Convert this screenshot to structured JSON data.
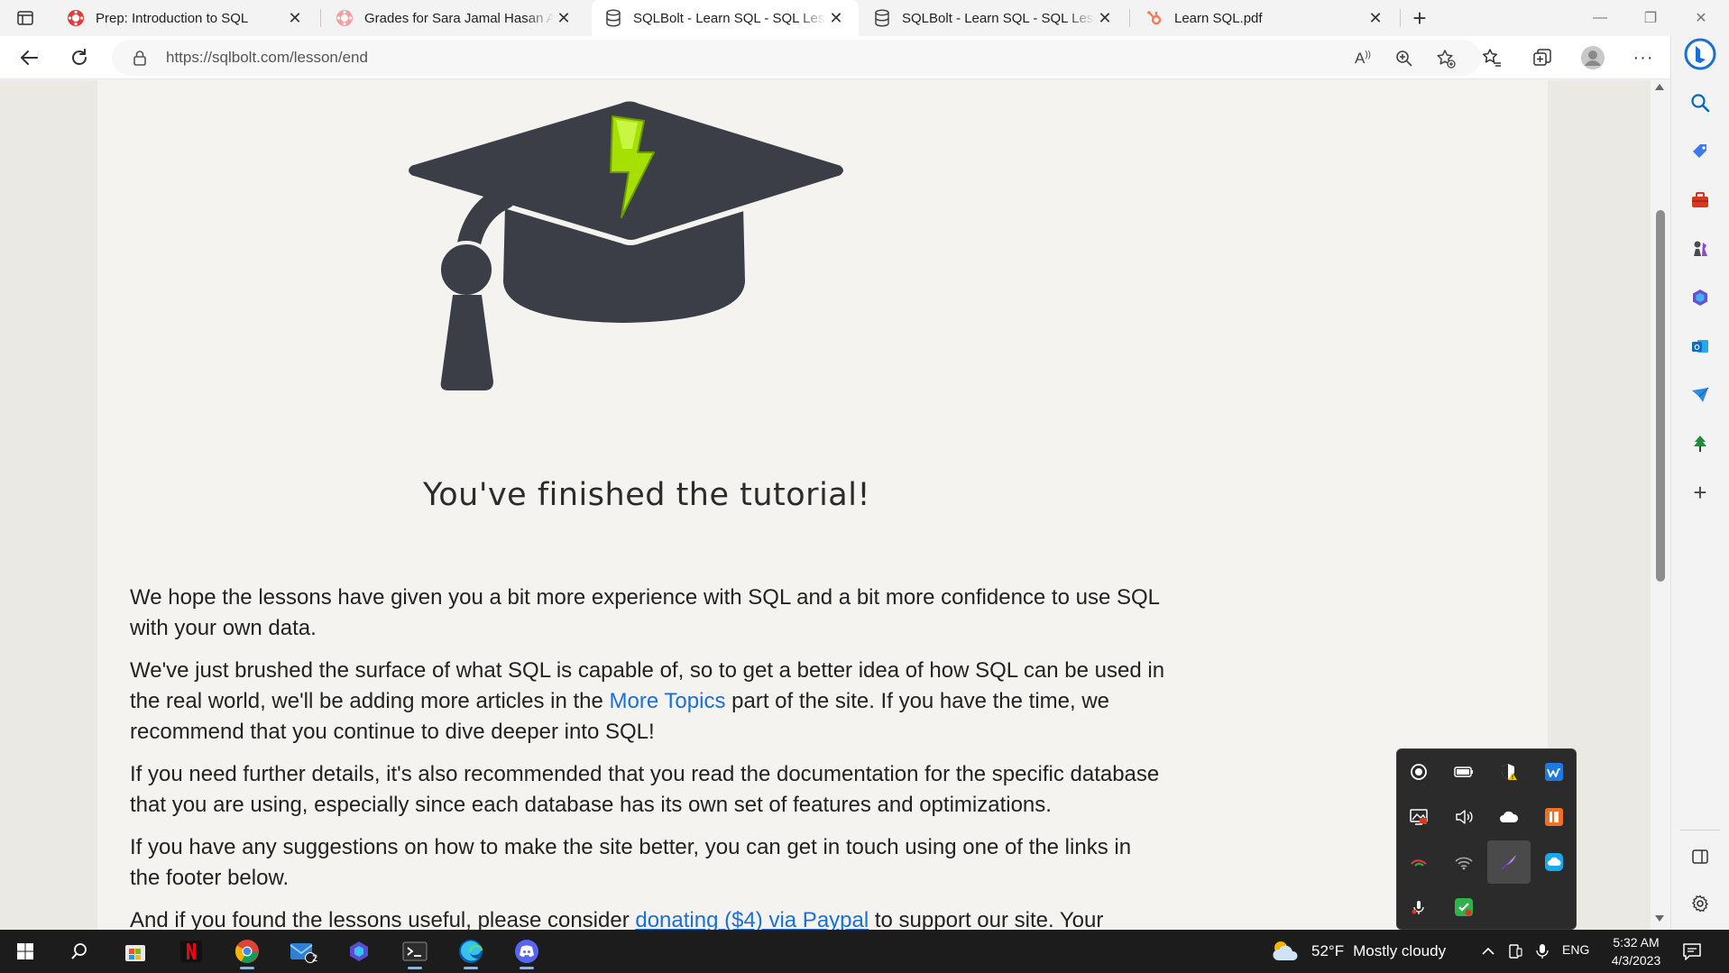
{
  "browser": {
    "tabs": [
      {
        "title": "Prep: Introduction to SQL",
        "icon": "codepath-icon",
        "active": false
      },
      {
        "title": "Grades for Sara Jamal Hasan Alki",
        "icon": "codepath-icon",
        "active": false
      },
      {
        "title": "SQLBolt - Learn SQL - SQL Lesso",
        "icon": "database-icon",
        "active": true
      },
      {
        "title": "SQLBolt - Learn SQL - SQL Lesso",
        "icon": "database-icon",
        "active": false
      },
      {
        "title": "Learn SQL.pdf",
        "icon": "hubspot-icon",
        "active": false
      }
    ],
    "url": "https://sqlbolt.com/lesson/end"
  },
  "page": {
    "heading": "You've finished the tutorial!",
    "p1": "We hope the lessons have given you a bit more experience with SQL and a bit more confidence to use SQL with your own data.",
    "p2_before": "We've just brushed the surface of what SQL is capable of, so to get a better idea of how SQL can be used in the real world, we'll be adding more articles in the ",
    "p2_link": "More Topics",
    "p2_after": " part of the site. If you have the time, we recommend that you continue to dive deeper into SQL!",
    "p3": "If you need further details, it's also recommended that you read the documentation for the specific database that you are using, especially since each database has its own set of features and optimizations.",
    "p4": "If you have any suggestions on how to make the site better, you can get in touch using one of the links in the footer below.",
    "p5_before": "And if you found the lessons useful, please consider ",
    "p5_link": "donating ($4) via Paypal",
    "p5_after": " to support our site. Your"
  },
  "taskbar": {
    "weather_temp": "52°F",
    "weather_cond": "Mostly cloudy",
    "language": "ENG",
    "time": "5:32 AM",
    "date": "4/3/2023",
    "mail_badge": "2"
  },
  "colors": {
    "link": "#1a6fd8",
    "cap": "#3b3e46",
    "bolt": "#a5e000",
    "edge_accent": "#0067c0"
  }
}
